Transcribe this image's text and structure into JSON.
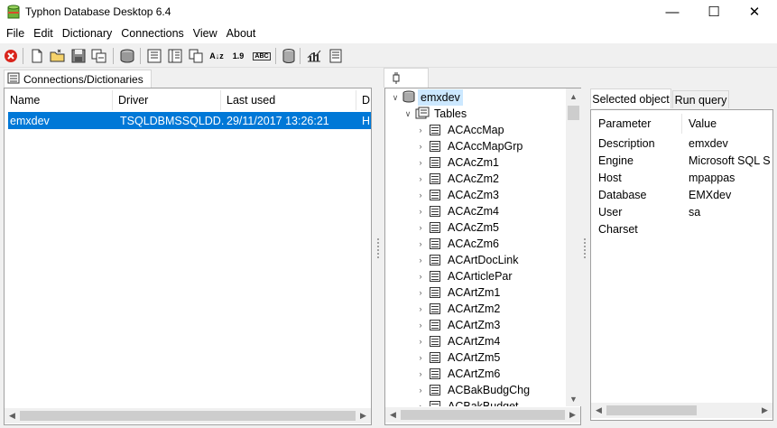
{
  "window": {
    "title": "Typhon Database Desktop 6.4",
    "controls": {
      "minimize": "—",
      "maximize": "☐",
      "close": "✕"
    }
  },
  "menu": [
    "File",
    "Edit",
    "Dictionary",
    "Connections",
    "View",
    "About"
  ],
  "toolbar": {
    "icons": [
      "stop-icon",
      "new-document-icon",
      "open-folder-icon",
      "save-icon",
      "save-all-icon",
      "connections-icon",
      "columns-icon",
      "rows-icon",
      "copy-icon",
      "sort-az-icon",
      "number-format-icon",
      "abc-format-icon",
      "database-icon",
      "chart-icon",
      "notes-icon"
    ],
    "sort_label": "A↓z",
    "number_label": "1.9",
    "abc_label": "ABC"
  },
  "left": {
    "tab_label": "Connections/Dictionaries",
    "columns": [
      "Name",
      "Driver",
      "Last used",
      "D"
    ],
    "rows": [
      {
        "name": "emxdev",
        "driver": "TSQLDBMSSQLDD...",
        "last_used": "29/11/2017 13:26:21",
        "d": "H",
        "selected": true
      }
    ]
  },
  "tree": {
    "root": "emxdev",
    "folder": "Tables",
    "tables": [
      "ACAccMap",
      "ACAccMapGrp",
      "ACAcZm1",
      "ACAcZm2",
      "ACAcZm3",
      "ACAcZm4",
      "ACAcZm5",
      "ACAcZm6",
      "ACArtDocLink",
      "ACArticlePar",
      "ACArtZm1",
      "ACArtZm2",
      "ACArtZm3",
      "ACArtZm4",
      "ACArtZm5",
      "ACArtZm6",
      "ACBakBudgChg",
      "ACBakBudget"
    ]
  },
  "right": {
    "tabs": [
      "Selected object",
      "Run query"
    ],
    "active_tab": "Selected object",
    "headers": {
      "param": "Parameter",
      "value": "Value"
    },
    "properties": [
      {
        "param": "Description",
        "value": "emxdev"
      },
      {
        "param": "Engine",
        "value": "Microsoft SQL S"
      },
      {
        "param": "Host",
        "value": "mpappas"
      },
      {
        "param": "Database",
        "value": "EMXdev"
      },
      {
        "param": "User",
        "value": "sa"
      },
      {
        "param": "Charset",
        "value": ""
      }
    ]
  },
  "colors": {
    "selection": "#0078d7",
    "panel_border": "#a0a0a0",
    "scroll_thumb": "#cdcdcd"
  }
}
